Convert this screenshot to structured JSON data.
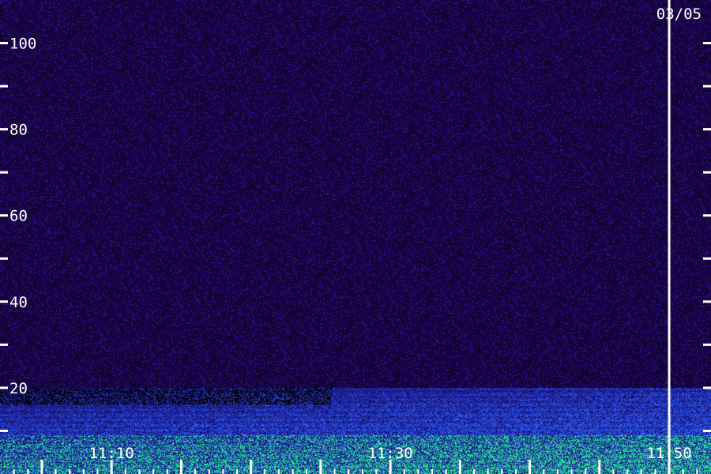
{
  "chart_data": {
    "type": "heatmap",
    "title": "",
    "xlabel": "",
    "ylabel": "",
    "date_label": "03/05",
    "y_axis": {
      "range": [
        0,
        110
      ],
      "major_ticks": [
        20,
        40,
        60,
        80,
        100
      ],
      "minor_ticks": [
        10,
        30,
        50,
        70,
        90
      ],
      "tick_labels": [
        "20",
        "40",
        "60",
        "80",
        "100"
      ]
    },
    "x_axis": {
      "range": [
        "11:02",
        "11:53"
      ],
      "label_times": [
        "11:10",
        "11:30",
        "11:50"
      ],
      "major_ticks": [
        "11:05",
        "11:10",
        "11:15",
        "11:20",
        "11:25",
        "11:30",
        "11:35",
        "11:40",
        "11:45",
        "11:50"
      ],
      "minor_ticks": [
        "11:03",
        "11:04",
        "11:06",
        "11:07",
        "11:08",
        "11:09",
        "11:11",
        "11:12",
        "11:13",
        "11:14",
        "11:16",
        "11:17",
        "11:18",
        "11:19",
        "11:21",
        "11:22",
        "11:23",
        "11:24",
        "11:26",
        "11:27",
        "11:28",
        "11:29",
        "11:31",
        "11:32",
        "11:33",
        "11:34",
        "11:36",
        "11:37",
        "11:38",
        "11:39",
        "11:41",
        "11:42",
        "11:43",
        "11:44",
        "11:46",
        "11:47",
        "11:48",
        "11:49",
        "11:51",
        "11:52"
      ]
    },
    "marker_time": "11:50",
    "colors": {
      "background_noise": "#2a0a5a",
      "low_band": "#1a3fd0",
      "hot": "#38e0a0",
      "marker": "#ffffff",
      "text": "#ffffff"
    }
  }
}
